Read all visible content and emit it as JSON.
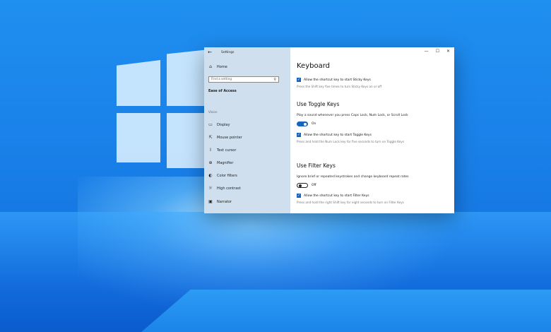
{
  "window": {
    "title": "Settings",
    "controls": {
      "minimize": "—",
      "maximize": "☐",
      "close": "✕"
    }
  },
  "sidebar": {
    "home": "Home",
    "search_placeholder": "Find a setting",
    "section": "Ease of Access",
    "group": "Vision",
    "items": [
      {
        "label": "Display",
        "icon": "display-icon"
      },
      {
        "label": "Mouse pointer",
        "icon": "mouse-pointer-icon"
      },
      {
        "label": "Text cursor",
        "icon": "text-cursor-icon"
      },
      {
        "label": "Magnifier",
        "icon": "magnifier-icon"
      },
      {
        "label": "Color filters",
        "icon": "color-filters-icon"
      },
      {
        "label": "High contrast",
        "icon": "high-contrast-icon"
      },
      {
        "label": "Narrator",
        "icon": "narrator-icon"
      }
    ]
  },
  "content": {
    "title": "Keyboard",
    "sticky": {
      "checkbox_label": "Allow the shortcut key to start Sticky Keys",
      "desc": "Press the Shift key five times to turn Sticky Keys on or off"
    },
    "toggle_keys": {
      "heading": "Use Toggle Keys",
      "text": "Play a sound whenever you press Caps Lock, Num Lock, or Scroll Lock",
      "state": "On",
      "checkbox_label": "Allow the shortcut key to start Toggle Keys",
      "desc": "Press and hold the Num Lock key for five seconds to turn on Toggle Keys"
    },
    "filter_keys": {
      "heading": "Use Filter Keys",
      "text": "Ignore brief or repeated keystrokes and change keyboard repeat rates",
      "state": "Off",
      "checkbox_label": "Allow the shortcut key to start Filter Keys",
      "desc": "Press and hold the right Shift key for eight seconds to turn on Filter Keys"
    }
  },
  "colors": {
    "accent": "#1565c0",
    "sidebar_bg": "#cedeec",
    "wallpaper": "#1a82ea"
  }
}
